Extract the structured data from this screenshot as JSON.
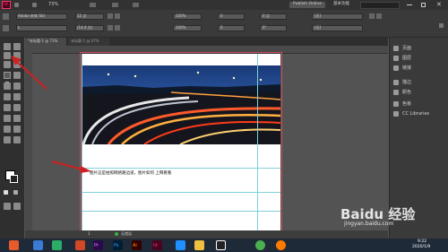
{
  "menubar": {
    "app_logo": "Id",
    "zoom": "73%",
    "publish_button": "Publish Online",
    "workspace": "基本功能",
    "search_placeholder": ""
  },
  "control_bar": {
    "font_name": "Adobe 宋体 Std",
    "font_style": "L",
    "size_field": "12 点",
    "leading_field": "(14.4 点)",
    "scale_horizontal": "100%",
    "scale_vertical": "100%",
    "tracking": "0",
    "kerning": "0",
    "baseline": "0 点",
    "skew": "0°",
    "language": "[无]",
    "paragraph_style": "[无]"
  },
  "tabs": [
    {
      "label": "*未标题-1 @ 73%"
    },
    {
      "label": "未标题-1 @ 67%"
    }
  ],
  "panels": [
    {
      "label": "页面",
      "icon": "pages-icon"
    },
    {
      "label": "图层",
      "icon": "layers-icon"
    },
    {
      "label": "链接",
      "icon": "links-icon"
    },
    {
      "label": "描边",
      "icon": "stroke-icon"
    },
    {
      "label": "颜色",
      "icon": "color-icon"
    },
    {
      "label": "色板",
      "icon": "swatches-icon"
    },
    {
      "label": "CC Libraries",
      "icon": "cc-libraries-icon"
    }
  ],
  "document": {
    "body_text": "图片这是拍照网络路边道，图片如何 上网看看"
  },
  "status": {
    "page": "1",
    "preflight": "无错误"
  },
  "taskbar": {
    "time": "9:22",
    "date": "2020/1/9",
    "apps": [
      "Pr",
      "Ps",
      "Ai",
      "Id"
    ]
  },
  "watermark": {
    "brand": "Baidu 经验",
    "url": "jingyan.baidu.com"
  },
  "colors": {
    "accent": "#d04a5a",
    "arrow": "#cc2222",
    "guide": "#7fd0d8"
  }
}
